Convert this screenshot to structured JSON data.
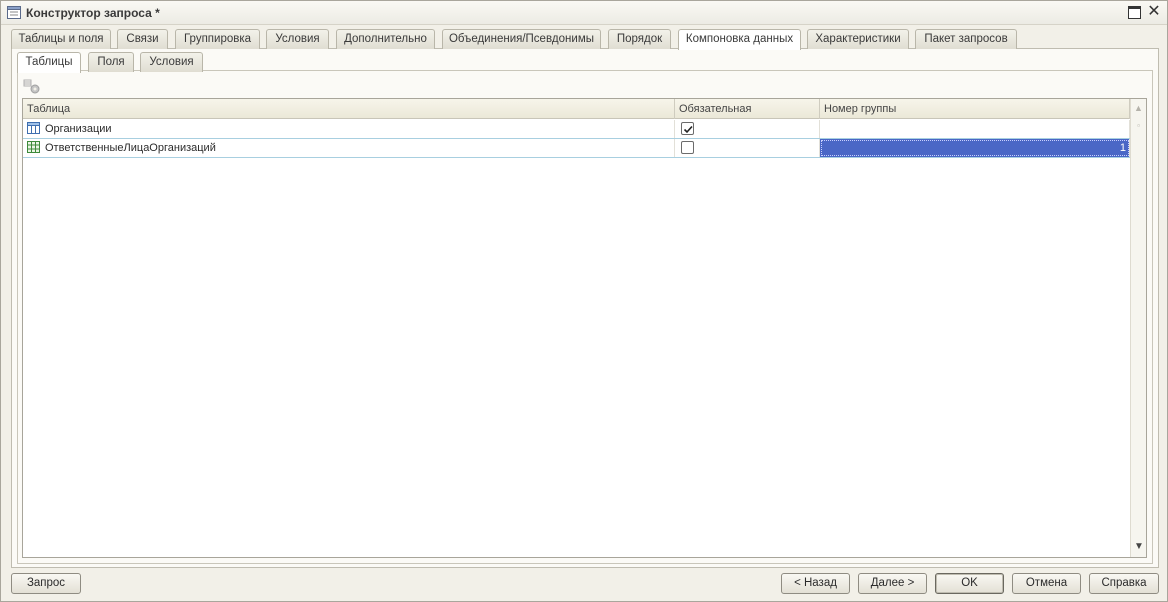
{
  "window": {
    "title": "Конструктор запроса *"
  },
  "main_tabs": [
    {
      "label": "Таблицы и поля"
    },
    {
      "label": "Связи"
    },
    {
      "label": "Группировка"
    },
    {
      "label": "Условия"
    },
    {
      "label": "Дополнительно"
    },
    {
      "label": "Объединения/Псевдонимы"
    },
    {
      "label": "Порядок"
    },
    {
      "label": "Компоновка данных",
      "active": true
    },
    {
      "label": "Характеристики"
    },
    {
      "label": "Пакет запросов"
    }
  ],
  "sub_tabs": [
    {
      "label": "Таблицы",
      "active": true
    },
    {
      "label": "Поля"
    },
    {
      "label": "Условия"
    }
  ],
  "grid": {
    "columns": {
      "table": "Таблица",
      "required": "Обязательная",
      "group_number": "Номер группы"
    },
    "rows": [
      {
        "name": "Организации",
        "icon": "table-icon",
        "required": true,
        "group_number": ""
      },
      {
        "name": "ОтветственныеЛицаОрганизаций",
        "icon": "register-icon",
        "required": false,
        "group_number": "1",
        "selected": true
      }
    ]
  },
  "buttons": {
    "query": "Запрос",
    "back": "< Назад",
    "next": "Далее >",
    "ok": "OK",
    "cancel": "Отмена",
    "help": "Справка"
  },
  "colors": {
    "selection": "#4a67c6",
    "background": "#f2f0e8"
  }
}
